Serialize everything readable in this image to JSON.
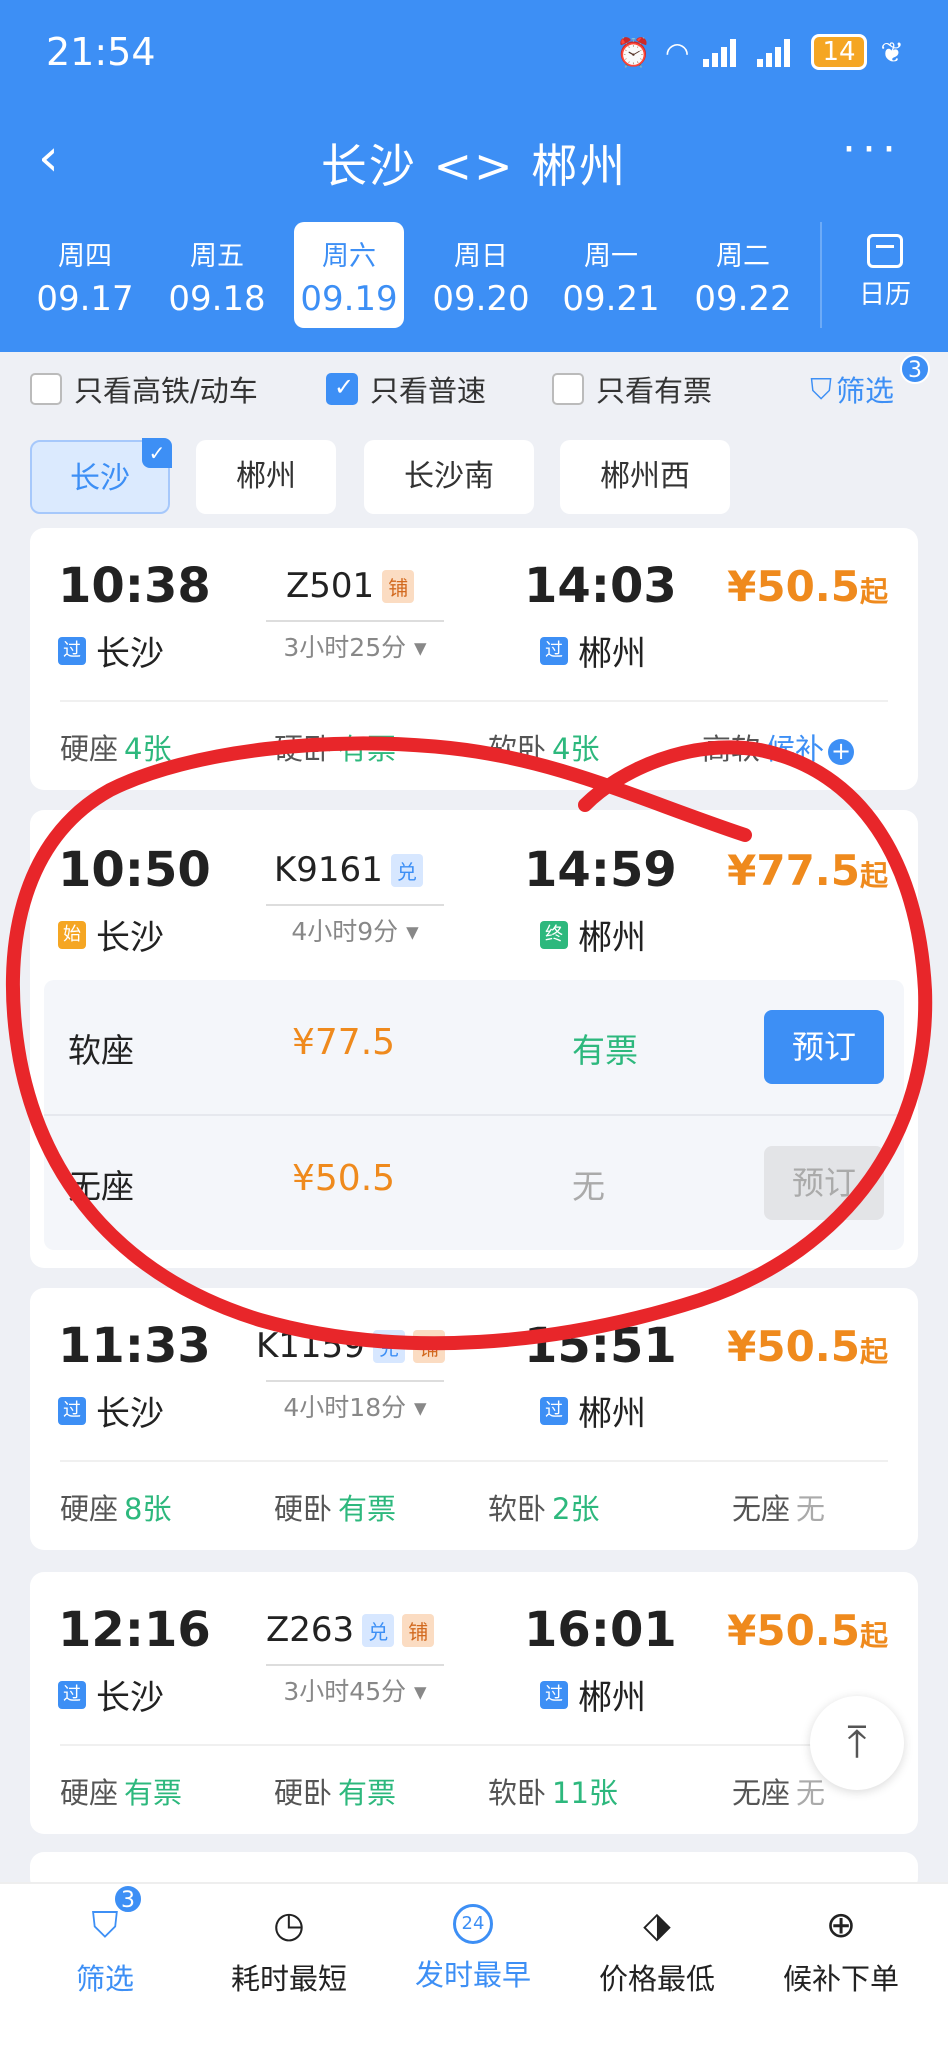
{
  "status": {
    "time": "21:54",
    "battery": "14"
  },
  "header": {
    "back_icon": "‹",
    "title": "长沙 <> 郴州",
    "more_icon": "···",
    "dates": [
      {
        "weekday": "周四",
        "date": "09.17"
      },
      {
        "weekday": "周五",
        "date": "09.18"
      },
      {
        "weekday": "周六",
        "date": "09.19"
      },
      {
        "weekday": "周日",
        "date": "09.20"
      },
      {
        "weekday": "周一",
        "date": "09.21"
      },
      {
        "weekday": "周二",
        "date": "09.22"
      }
    ],
    "active_date_index": 2,
    "calendar_label": "日历"
  },
  "filters": {
    "high_speed_only": "只看高铁/动车",
    "normal_only": "只看普速",
    "available_only": "只看有票",
    "filter_label": "筛选",
    "filter_count": "3",
    "normal_only_checked": true
  },
  "stations": [
    "长沙",
    "郴州",
    "长沙南",
    "郴州西"
  ],
  "trains": [
    {
      "depart_time": "10:38",
      "arrive_time": "14:03",
      "train_no": "Z501",
      "tags": [
        "铺"
      ],
      "from_tag": "过",
      "from": "长沙",
      "to_tag": "过",
      "to": "郴州",
      "duration": "3小时25分 ▾",
      "price": "¥50.5",
      "price_suffix": "起",
      "seats": [
        {
          "name": "硬座",
          "value": "4张"
        },
        {
          "name": "硬卧",
          "value": "有票"
        },
        {
          "name": "软卧",
          "value": "4张"
        },
        {
          "name": "高软",
          "value": "候补"
        }
      ]
    },
    {
      "depart_time": "10:50",
      "arrive_time": "14:59",
      "train_no": "K9161",
      "tags": [
        "兑"
      ],
      "from_tag": "始",
      "from": "长沙",
      "to_tag": "终",
      "to": "郴州",
      "duration": "4小时9分 ▾",
      "price": "¥77.5",
      "price_suffix": "起",
      "expanded": [
        {
          "seat": "软座",
          "price": "¥77.5",
          "status": "有票",
          "action": "预订"
        },
        {
          "seat": "无座",
          "price": "¥50.5",
          "status": "无",
          "action": "预订"
        }
      ]
    },
    {
      "depart_time": "11:33",
      "arrive_time": "15:51",
      "train_no": "K1159",
      "tags": [
        "兑",
        "铺"
      ],
      "from_tag": "过",
      "from": "长沙",
      "to_tag": "过",
      "to": "郴州",
      "duration": "4小时18分 ▾",
      "price": "¥50.5",
      "price_suffix": "起",
      "seats": [
        {
          "name": "硬座",
          "value": "8张"
        },
        {
          "name": "硬卧",
          "value": "有票"
        },
        {
          "name": "软卧",
          "value": "2张"
        },
        {
          "name": "无座",
          "value": "无"
        }
      ]
    },
    {
      "depart_time": "12:16",
      "arrive_time": "16:01",
      "train_no": "Z263",
      "tags": [
        "兑",
        "铺"
      ],
      "from_tag": "过",
      "from": "长沙",
      "to_tag": "过",
      "to": "郴州",
      "duration": "3小时45分 ▾",
      "price": "¥50.5",
      "price_suffix": "起",
      "seats": [
        {
          "name": "硬座",
          "value": "有票"
        },
        {
          "name": "硬卧",
          "value": "有票"
        },
        {
          "name": "软卧",
          "value": "11张"
        },
        {
          "name": "无座",
          "value": "无"
        }
      ]
    }
  ],
  "bottom_nav": [
    {
      "label": "筛选",
      "icon": "filter-icon",
      "glyph": "⛉",
      "badge": "3"
    },
    {
      "label": "耗时最短",
      "icon": "stopwatch-icon",
      "glyph": "◷"
    },
    {
      "label": "发时最早",
      "icon": "clock-24-icon",
      "glyph": "24"
    },
    {
      "label": "价格最低",
      "icon": "price-tag-icon",
      "glyph": "⬗"
    },
    {
      "label": "候补下单",
      "icon": "cart-plus-icon",
      "glyph": "⊕"
    }
  ],
  "scroll_top_icon": "⤒",
  "colors": {
    "primary": "#3d8ff5",
    "price": "#ef8a1d",
    "available": "#2db87d",
    "annotation": "#e8262a"
  }
}
